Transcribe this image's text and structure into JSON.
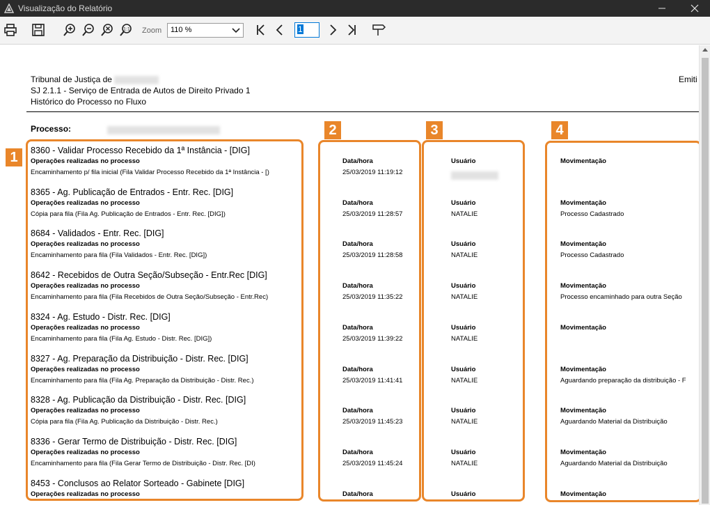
{
  "window": {
    "title": "Visualização do Relatório"
  },
  "toolbar": {
    "zoom_label": "Zoom",
    "zoom_value": "110 %",
    "page_value": "1",
    "icons": [
      "print-icon",
      "save-icon",
      "zoom-in-icon",
      "zoom-out-icon",
      "zoom-fit-icon",
      "zoom-actual-icon",
      "first-page-icon",
      "prev-page-icon",
      "next-page-icon",
      "last-page-icon",
      "export-icon"
    ]
  },
  "report": {
    "header_line1": "Tribunal de Justiça de",
    "header_line2": "SJ 2.1.1 - Serviço de Entrada de Autos de Direito Privado 1",
    "header_line3": "Histórico do Processo no Fluxo",
    "emitido": "Emiti",
    "processo_label": "Processo:",
    "col_date": "Data/hora",
    "col_user": "Usuário",
    "col_mov": "Movimentação",
    "op_label": "Operações realizadas no processo",
    "groups": [
      {
        "title": "8360 - Validar Processo Recebido da 1ª Instância - [DIG]",
        "desc": "Encaminhamento p/ fila inicial (Fila Validar Processo Recebido da 1ª Instância - [)",
        "date": "25/03/2019 11:19:12",
        "user": "",
        "mov": ""
      },
      {
        "title": "8365 - Ag. Publicação de Entrados - Entr. Rec. [DIG]",
        "desc": "Cópia para fila (Fila Ag. Publicação de Entrados - Entr. Rec. [DIG])",
        "date": "25/03/2019 11:28:57",
        "user": "NATALIE",
        "mov": "Processo Cadastrado"
      },
      {
        "title": "8684 - Validados - Entr. Rec. [DIG]",
        "desc": "Encaminhamento para fila (Fila Validados - Entr. Rec. [DIG])",
        "date": "25/03/2019 11:28:58",
        "user": "NATALIE",
        "mov": "Processo Cadastrado"
      },
      {
        "title": "8642 - Recebidos de Outra Seção/Subseção - Entr.Rec [DIG]",
        "desc": "Encaminhamento para fila (Fila Recebidos de Outra Seção/Subseção - Entr.Rec)",
        "date": "25/03/2019 11:35:22",
        "user": "NATALIE",
        "mov": "Processo encaminhado para outra Seção"
      },
      {
        "title": "8324 - Ag. Estudo - Distr. Rec. [DIG]",
        "desc": "Encaminhamento para fila (Fila Ag. Estudo - Distr. Rec. [DIG])",
        "date": "25/03/2019 11:39:22",
        "user": "NATALIE",
        "mov": ""
      },
      {
        "title": "8327 - Ag. Preparação da Distribuição - Distr. Rec. [DIG]",
        "desc": "Encaminhamento para fila (Fila Ag. Preparação da Distribuição - Distr. Rec.)",
        "date": "25/03/2019 11:41:41",
        "user": "NATALIE",
        "mov": "Aguardando preparação da distribuição - F"
      },
      {
        "title": "8328 - Ag. Publicação da Distribuição - Distr. Rec. [DIG]",
        "desc": "Cópia para fila (Fila Ag. Publicação da Distribuição - Distr. Rec.)",
        "date": "25/03/2019 11:45:23",
        "user": "NATALIE",
        "mov": "Aguardando Material da Distribuição"
      },
      {
        "title": "8336 - Gerar Termo de Distribuição - Distr. Rec. [DIG]",
        "desc": "Encaminhamento para fila (Fila Gerar Termo de Distribuição - Distr. Rec. [DI)",
        "date": "25/03/2019 11:45:24",
        "user": "NATALIE",
        "mov": "Aguardando Material da Distribuição"
      },
      {
        "title": "8453 - Conclusos ao Relator Sorteado - Gabinete [DIG]",
        "desc": "",
        "date": "",
        "user": "",
        "mov": ""
      }
    ]
  },
  "annotations": {
    "b1": "1",
    "b2": "2",
    "b3": "3",
    "b4": "4",
    "color": "#e9862a"
  }
}
